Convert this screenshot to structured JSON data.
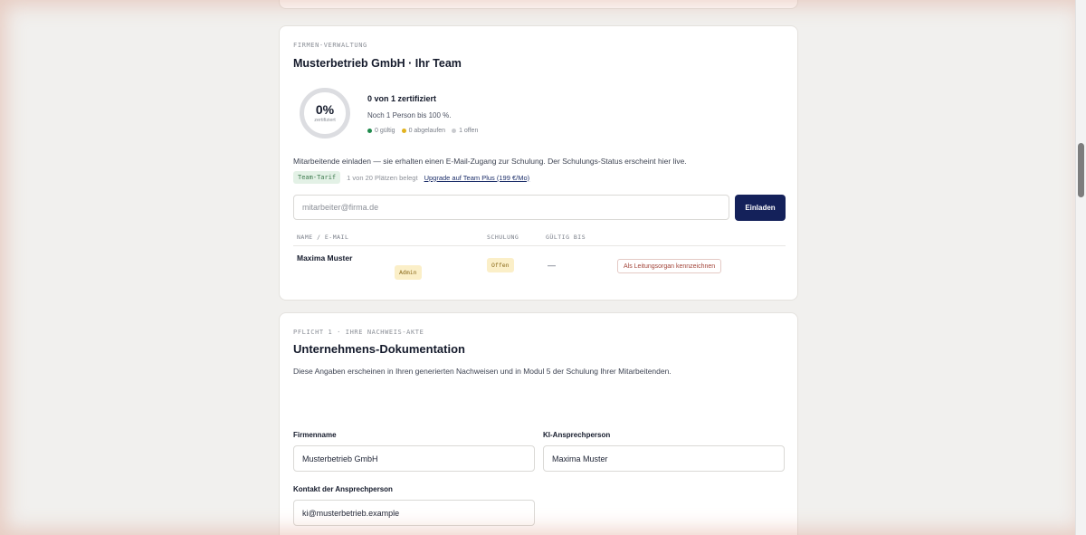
{
  "team": {
    "eyebrow": "FIRMEN-VERWALTUNG",
    "title": "Musterbetrieb GmbH · Ihr Team",
    "progress": {
      "percent_label": "0%",
      "percent_value": 0,
      "ring_caption": "zertifiziert",
      "certified_line": "0 von 1 zertifiziert",
      "remaining_line": "Noch 1 Person bis 100 %.",
      "legend": [
        {
          "label": "0 gültig",
          "color": "#1f8a4c"
        },
        {
          "label": "0 abgelaufen",
          "color": "#e2b320"
        },
        {
          "label": "1 offen",
          "color": "#c9cbcf"
        }
      ]
    },
    "invite_text": "Mitarbeitende einladen — sie erhalten einen E-Mail-Zugang zur Schulung. Der Schulungs-Status erscheint hier live.",
    "tarif_badge": "Team-Tarif",
    "tarif_info": "1 von 20 Plätzen belegt",
    "upgrade_link": "Upgrade auf Team Plus (199 €/Mo)",
    "email_placeholder": "mitarbeiter@firma.de",
    "invite_button": "Einladen",
    "table": {
      "headers": [
        "NAME / E-MAIL",
        "SCHULUNG",
        "GÜLTIG BIS"
      ],
      "rows": [
        {
          "name": "Maxima Muster",
          "role_badge": "Admin",
          "status": "Offen",
          "valid_until": "—",
          "action": "Als Leitungsorgan kennzeichnen"
        }
      ]
    }
  },
  "docs": {
    "eyebrow": "PFLICHT 1 · IHRE NACHWEIS-AKTE",
    "title": "Unternehmens-Dokumentation",
    "description": "Diese Angaben erscheinen in Ihren generierten Nachweisen und in Modul 5 der Schulung Ihrer Mitarbeitenden.",
    "fields": {
      "company_label": "Firmenname",
      "company_value": "Musterbetrieb GmbH",
      "contact_person_label": "KI-Ansprechperson",
      "contact_person_value": "Maxima Muster",
      "contact_label": "Kontakt der Ansprechperson",
      "contact_value": "ki@musterbetrieb.example"
    }
  }
}
